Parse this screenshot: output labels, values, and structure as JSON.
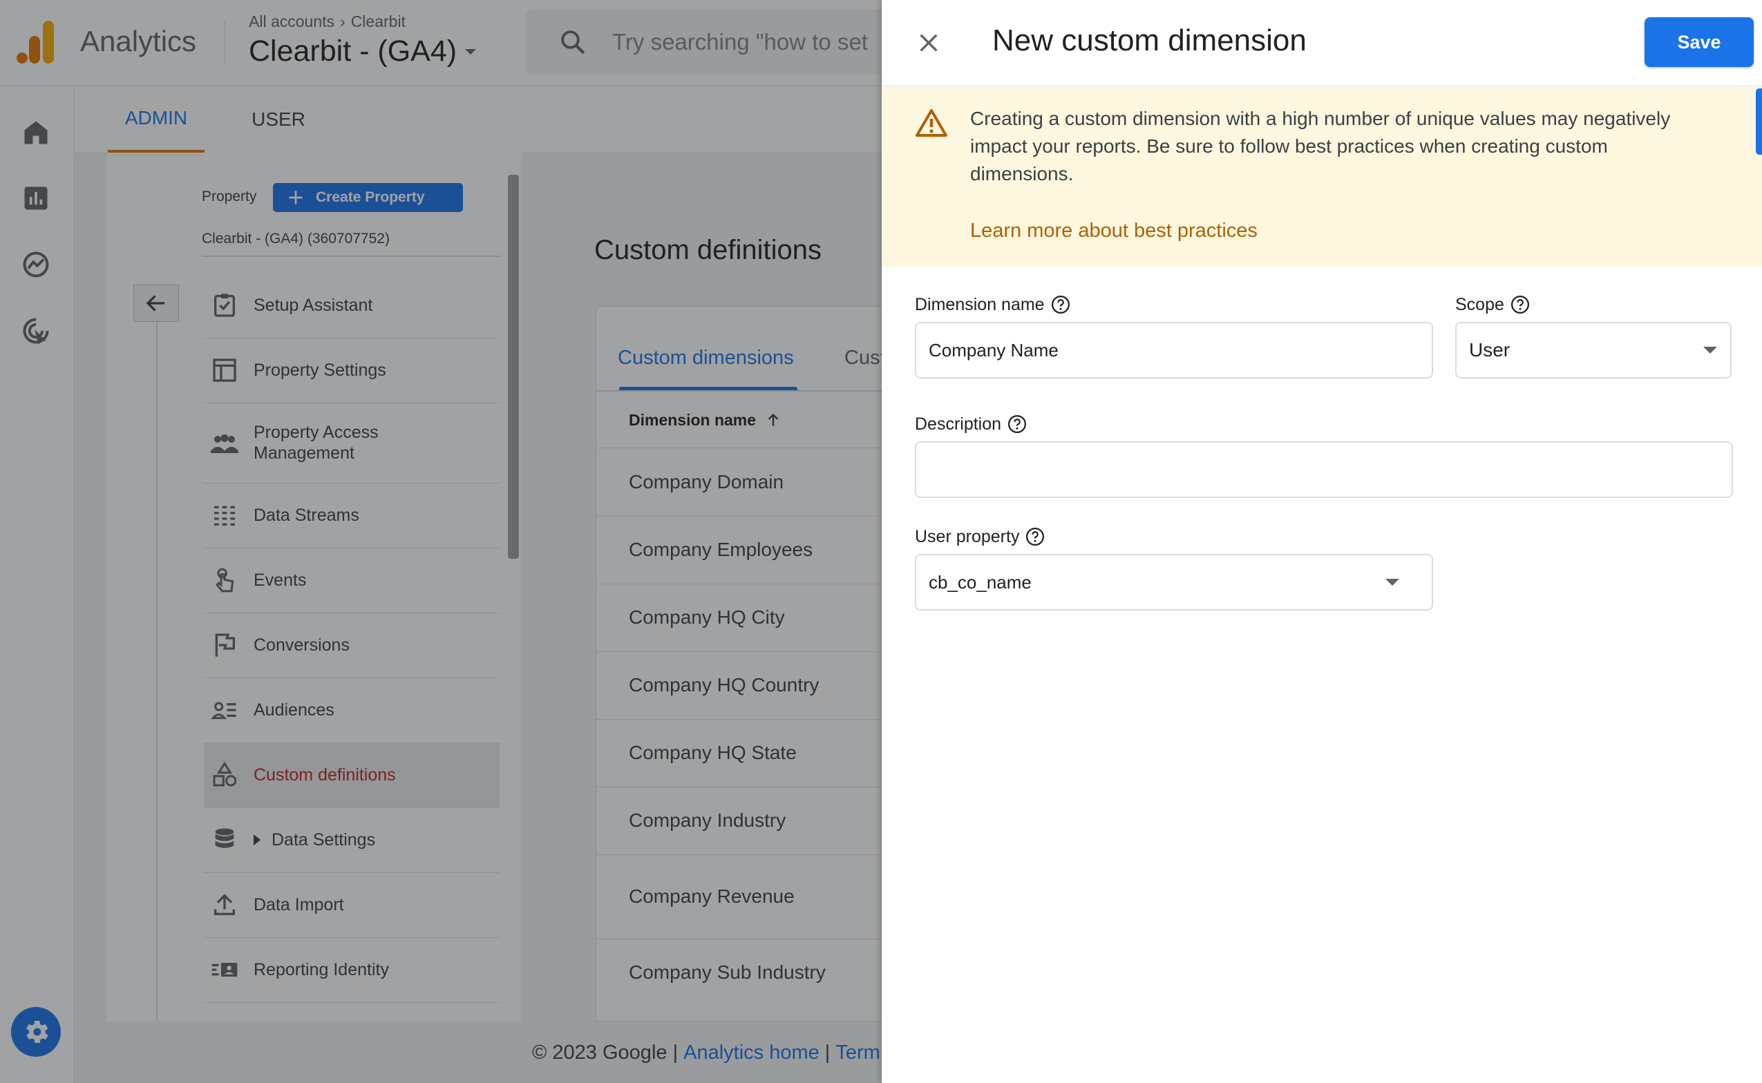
{
  "app": {
    "product": "Analytics",
    "breadcrumb_root": "All accounts",
    "breadcrumb_account": "Clearbit",
    "property_name": "Clearbit - (GA4)",
    "search_placeholder": "Try searching \"how to set"
  },
  "tabs": {
    "admin": "ADMIN",
    "user": "USER"
  },
  "property_panel": {
    "label": "Property",
    "create_button": "Create Property",
    "property_id_text": "Clearbit - (GA4) (360707752)"
  },
  "nav": [
    {
      "label": "Setup Assistant",
      "icon": "checklist-icon"
    },
    {
      "label": "Property Settings",
      "icon": "layout-icon"
    },
    {
      "label": "Property Access Management",
      "icon": "people-icon"
    },
    {
      "label": "Data Streams",
      "icon": "streams-icon"
    },
    {
      "label": "Events",
      "icon": "touch-icon"
    },
    {
      "label": "Conversions",
      "icon": "flag-icon"
    },
    {
      "label": "Audiences",
      "icon": "audience-icon"
    },
    {
      "label": "Custom definitions",
      "icon": "shapes-icon",
      "active": true
    },
    {
      "label": "Data Settings",
      "icon": "database-icon"
    },
    {
      "label": "Data Import",
      "icon": "upload-icon"
    },
    {
      "label": "Reporting Identity",
      "icon": "identity-icon"
    }
  ],
  "content": {
    "title": "Custom definitions",
    "tab_dimensions": "Custom dimensions",
    "tab_metrics_partial": "Cust",
    "column_header": "Dimension name",
    "rows": [
      "Company Domain",
      "Company Employees",
      "Company HQ City",
      "Company HQ Country",
      "Company HQ State",
      "Company Industry",
      "Company Revenue",
      "Company Sub Industry"
    ]
  },
  "footer": {
    "copyright": "© 2023 Google |",
    "home_link": "Analytics home",
    "sep": "|",
    "terms_partial": "Term"
  },
  "drawer": {
    "title": "New custom dimension",
    "save_label": "Save",
    "warning_text": "Creating a custom dimension with a high number of unique values may negatively impact your reports. Be sure to follow best practices when creating custom dimensions.",
    "learn_more": "Learn more about best practices",
    "dimension_name_label": "Dimension name",
    "dimension_name_value": "Company Name",
    "scope_label": "Scope",
    "scope_value": "User",
    "description_label": "Description",
    "description_value": "",
    "user_property_label": "User property",
    "user_property_value": "cb_co_name"
  },
  "colors": {
    "primary": "#1a73e8",
    "active_nav_text": "#c5221f",
    "warning_bg": "#fef7e0",
    "warning_text_link": "#b06000",
    "logo_orange": "#e37400",
    "logo_yellow": "#f9ab00"
  }
}
